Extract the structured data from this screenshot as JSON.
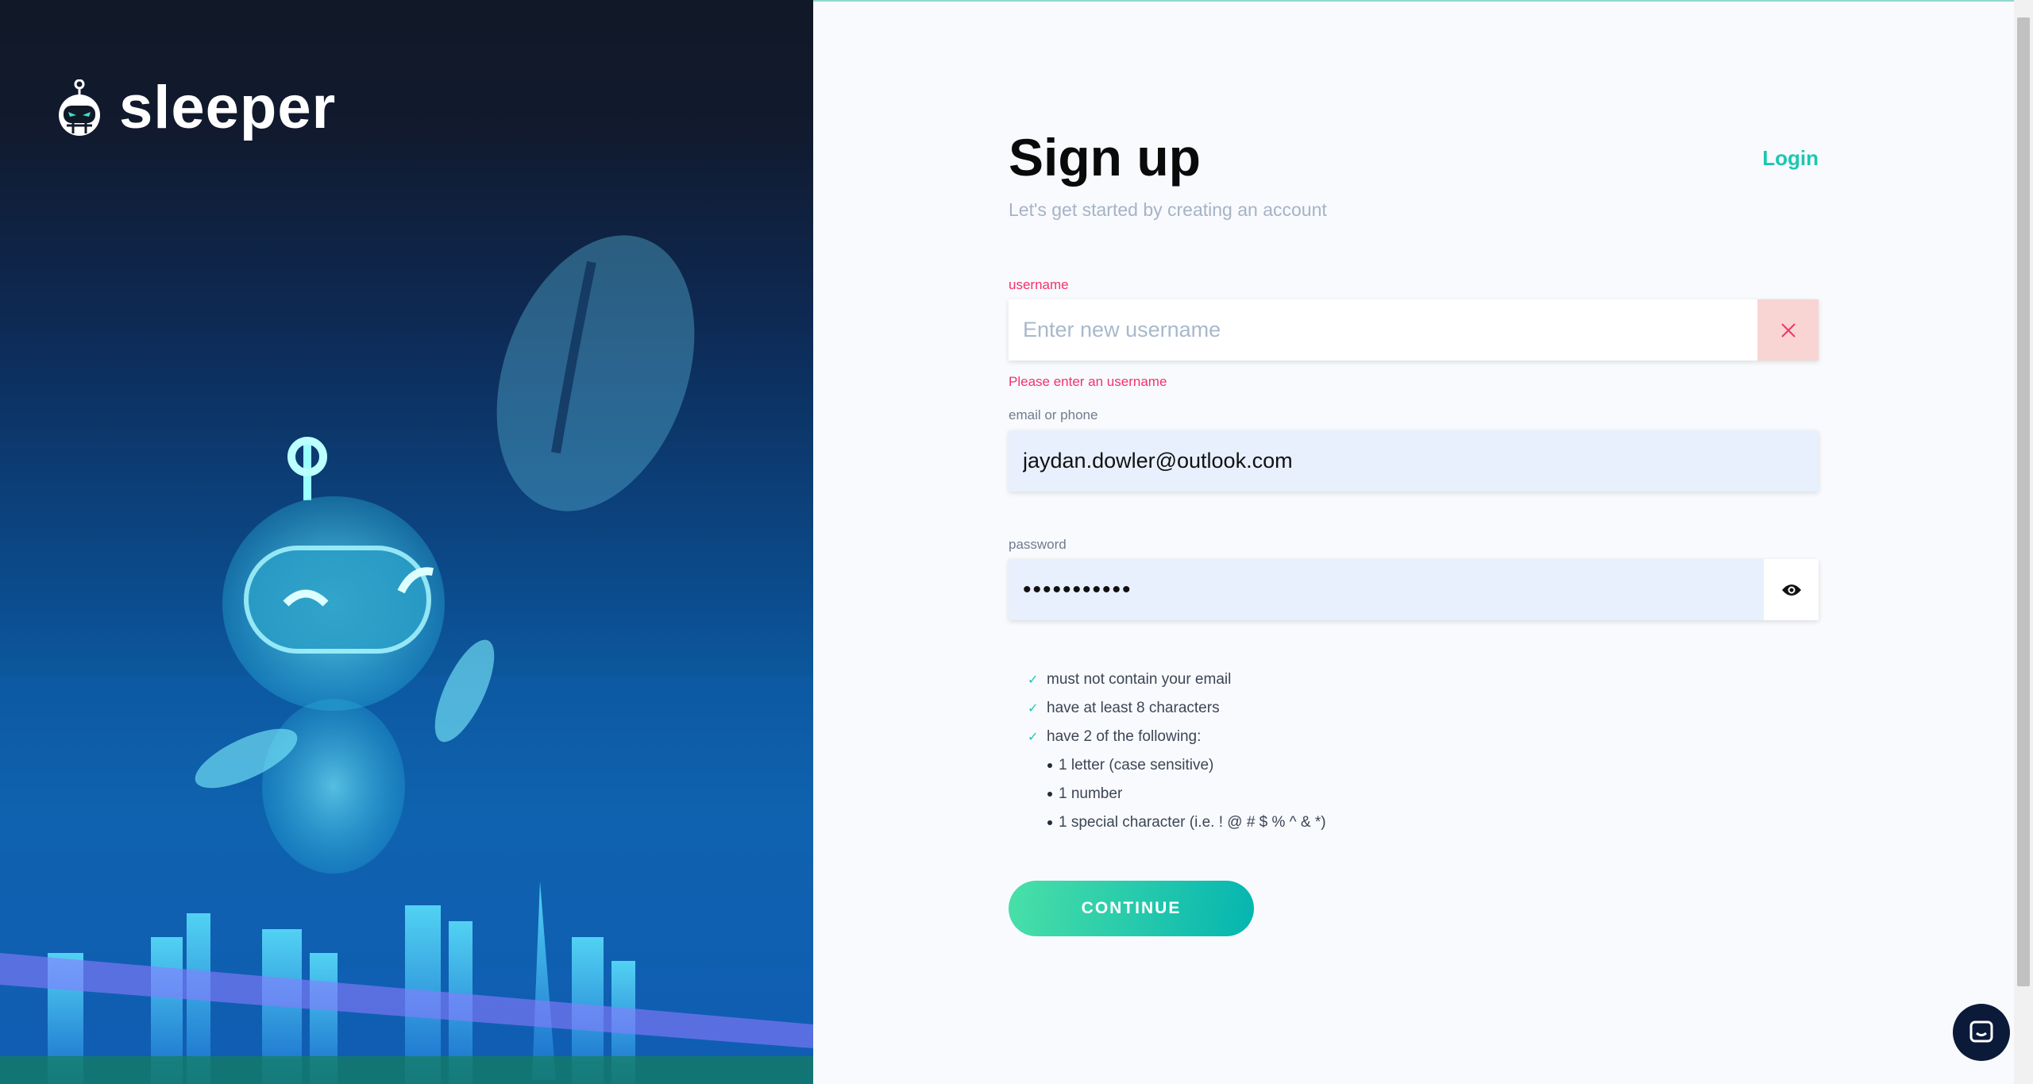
{
  "brand": {
    "name": "sleeper"
  },
  "header": {
    "title": "Sign up",
    "subtitle": "Let's get started by creating an account",
    "login_link": "Login"
  },
  "form": {
    "username": {
      "label": "username",
      "placeholder": "Enter new username",
      "value": "",
      "error": "Please enter an username"
    },
    "email": {
      "label": "email or phone",
      "value": "jaydan.dowler@outlook.com"
    },
    "password": {
      "label": "password",
      "value": "passwordxx1"
    },
    "rules": [
      {
        "text": "must not contain your email",
        "met": true
      },
      {
        "text": "have at least 8 characters",
        "met": true
      },
      {
        "text": "have 2 of the following:",
        "met": true
      }
    ],
    "sub_rules": [
      "1 letter (case sensitive)",
      "1 number",
      "1 special character (i.e. ! @ # $ % ^ & *)"
    ],
    "continue_label": "CONTINUE"
  },
  "colors": {
    "accent": "#1bc7b2",
    "error": "#f5326a",
    "left_bg": "#111827"
  }
}
